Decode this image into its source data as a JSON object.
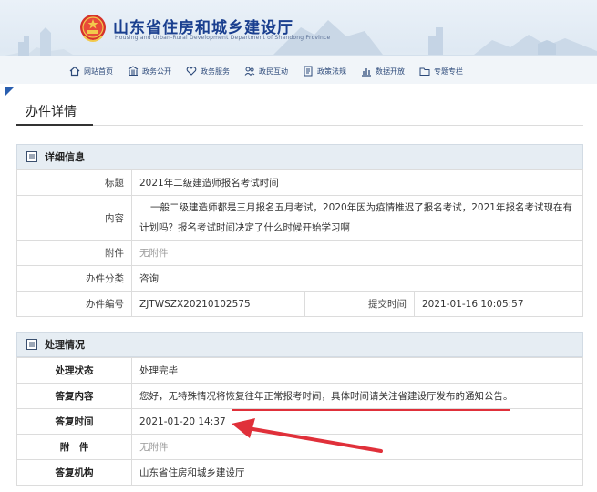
{
  "header": {
    "site_title": "山东省住房和城乡建设厅",
    "site_subtitle": "Housing and Urban-Rural Development Department of Shandong Province",
    "nav": [
      {
        "label": "网站首页",
        "icon": "home-icon"
      },
      {
        "label": "政务公开",
        "icon": "building-icon"
      },
      {
        "label": "政务服务",
        "icon": "heart-hand-icon"
      },
      {
        "label": "政民互动",
        "icon": "people-icon"
      },
      {
        "label": "政策法规",
        "icon": "document-icon"
      },
      {
        "label": "数据开放",
        "icon": "chart-icon"
      },
      {
        "label": "专题专栏",
        "icon": "folder-icon"
      }
    ]
  },
  "page": {
    "title": "办件详情"
  },
  "detail": {
    "heading": "详细信息",
    "title_label": "标题",
    "title_value": "2021年二级建造师报名考试时间",
    "content_label": "内容",
    "content_value": "一般二级建造师都是三月报名五月考试，2020年因为疫情推迟了报名考试，2021年报名考试现在有计划吗？报名考试时间决定了什么时候开始学习啊",
    "attachment_label": "附件",
    "attachment_value": "无附件",
    "category_label": "办件分类",
    "category_value": "咨询",
    "number_label": "办件编号",
    "number_value": "ZJTWSZX20210102575",
    "submit_time_label": "提交时间",
    "submit_time_value": "2021-01-16 10:05:57"
  },
  "handling": {
    "heading": "处理情况",
    "status_label": "处理状态",
    "status_value": "处理完毕",
    "reply_label": "答复内容",
    "reply_value": "您好，无特殊情况将恢复往年正常报考时间，具体时间请关注省建设厅发布的通知公告。",
    "reply_time_label": "答复时间",
    "reply_time_value": "2021-01-20 14:37",
    "attachment_label": "附　件",
    "attachment_value": "无附件",
    "org_label": "答复机构",
    "org_value": "山东省住房和城乡建设厅"
  },
  "colors": {
    "brand_blue": "#1a3f8f",
    "panel_head_bg": "#e6edf3",
    "annotation_red": "#e0303a"
  }
}
